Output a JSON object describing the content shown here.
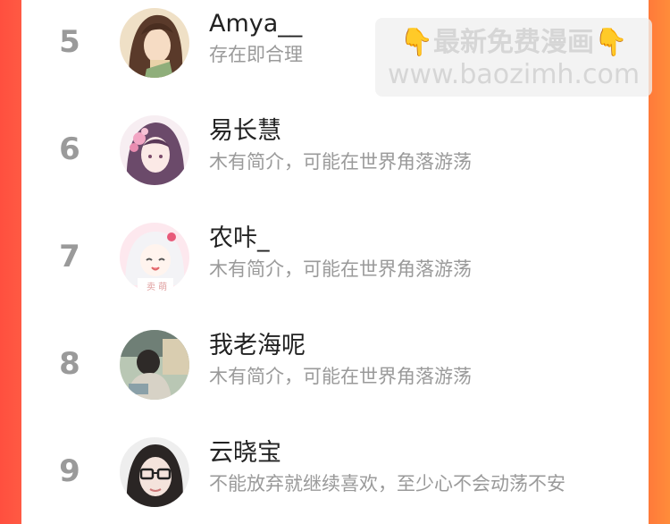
{
  "ranking": {
    "items": [
      {
        "rank": "5",
        "name": "Amya__",
        "bio": "存在即合理",
        "avatar_icon": "avatar-anime-man-icon"
      },
      {
        "rank": "6",
        "name": "易长慧",
        "bio": "木有简介，可能在世界角落游荡",
        "avatar_icon": "avatar-anime-girl-flowers-icon"
      },
      {
        "rank": "7",
        "name": "农咔_",
        "bio": "木有简介，可能在世界角落游荡",
        "avatar_icon": "avatar-anime-girl-white-hair-icon"
      },
      {
        "rank": "8",
        "name": "我老海呢",
        "bio": "木有简介，可能在世界角落游荡",
        "avatar_icon": "avatar-photo-person-icon"
      },
      {
        "rank": "9",
        "name": "云晓宝",
        "bio": "不能放弃就继续喜欢，至少心不会动荡不安",
        "avatar_icon": "avatar-photo-glasses-icon"
      }
    ]
  },
  "watermark": {
    "hand_left": "👇",
    "title": "最新免费漫画",
    "hand_right": "👇",
    "url": "www.baozimh.com"
  },
  "colors": {
    "left_edge": "#ff4f3f",
    "right_edge": "#ff7a3a",
    "rank_gray": "#9a9a9a",
    "name_black": "#222222"
  }
}
